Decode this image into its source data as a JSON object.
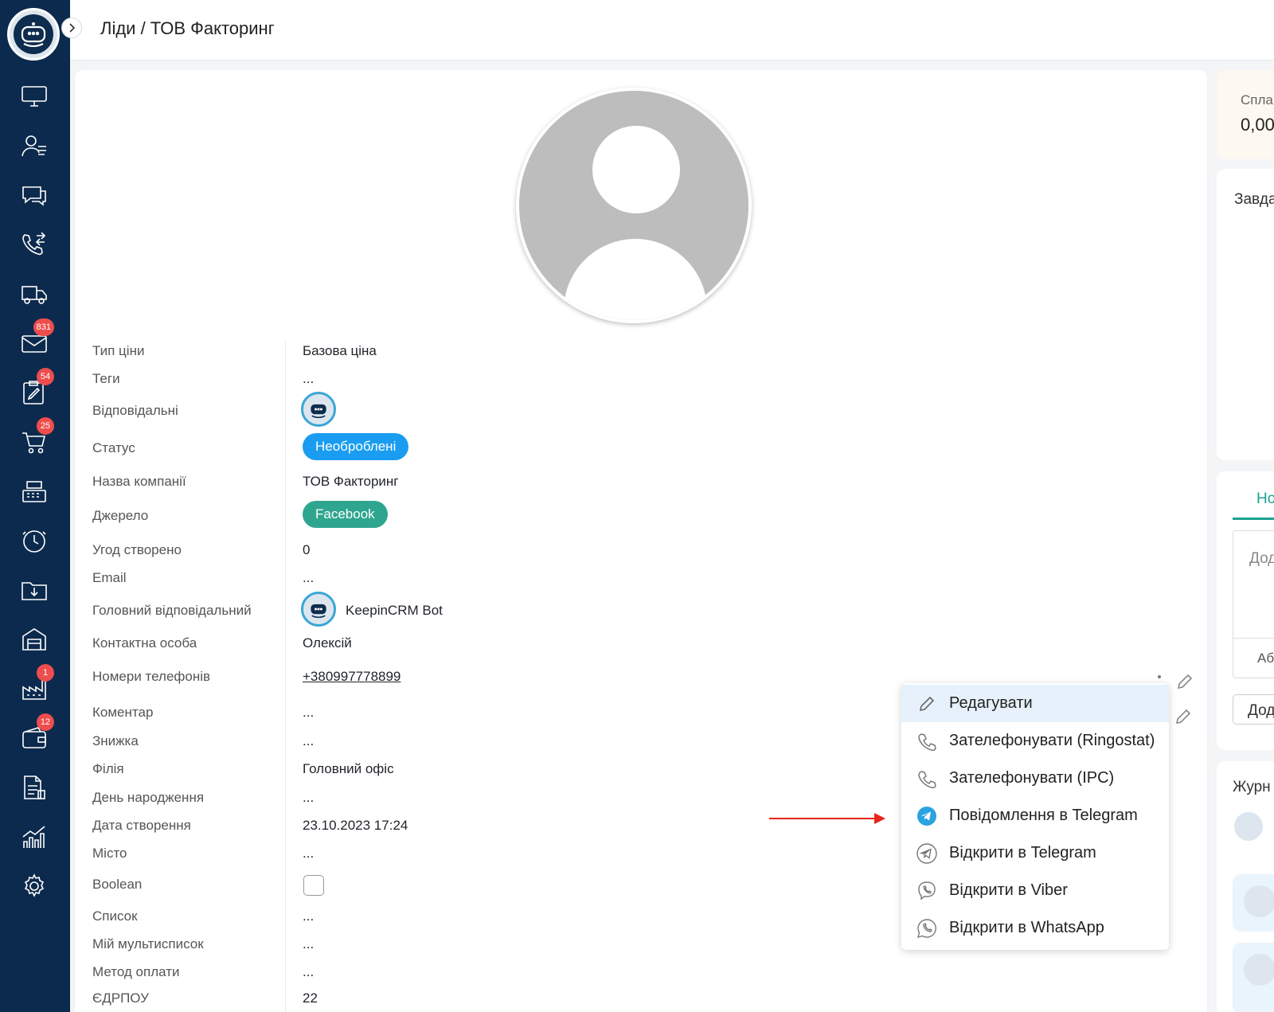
{
  "sidebar": {
    "items": [
      {
        "name": "desktop-icon"
      },
      {
        "name": "contacts-icon"
      },
      {
        "name": "chat-icon"
      },
      {
        "name": "calls-icon"
      },
      {
        "name": "delivery-icon"
      },
      {
        "name": "mail-icon",
        "badge": "831"
      },
      {
        "name": "tasks-icon",
        "badge": "54"
      },
      {
        "name": "cart-icon",
        "badge": "25"
      },
      {
        "name": "cash-register-icon"
      },
      {
        "name": "clock-icon"
      },
      {
        "name": "download-folder-icon"
      },
      {
        "name": "warehouse-icon"
      },
      {
        "name": "factory-icon",
        "badge": "1"
      },
      {
        "name": "wallet-icon",
        "badge": "12"
      },
      {
        "name": "documents-icon"
      },
      {
        "name": "analytics-icon"
      },
      {
        "name": "settings-icon"
      }
    ]
  },
  "header": {
    "breadcrumb": "Ліди / ТОВ Факторинг"
  },
  "fields": {
    "price_type": {
      "label": "Тип ціни",
      "value": "Базова ціна"
    },
    "tags": {
      "label": "Теги",
      "value": "..."
    },
    "responsible": {
      "label": "Відповідальні"
    },
    "status": {
      "label": "Статус",
      "value": "Необроблені",
      "color": "#1a9df0"
    },
    "company": {
      "label": "Назва компанії",
      "value": "ТОВ Факторинг"
    },
    "source": {
      "label": "Джерело",
      "value": "Facebook",
      "color": "#2ea68f"
    },
    "deals": {
      "label": "Угод створено",
      "value": "0"
    },
    "email": {
      "label": "Email",
      "value": "..."
    },
    "main_responsible": {
      "label": "Головний відповідальний",
      "value": "KeepinCRM Bot"
    },
    "contact": {
      "label": "Контактна особа",
      "value": "Олексій"
    },
    "phones": {
      "label": "Номери телефонів",
      "value": "+380997778899"
    },
    "comment": {
      "label": "Коментар",
      "value": "..."
    },
    "discount": {
      "label": "Знижка",
      "value": "..."
    },
    "branch": {
      "label": "Філія",
      "value": "Головний офіс"
    },
    "birthday": {
      "label": "День народження",
      "value": "..."
    },
    "created": {
      "label": "Дата створення",
      "value": "23.10.2023 17:24"
    },
    "city": {
      "label": "Місто",
      "value": "..."
    },
    "boolean": {
      "label": "Boolean"
    },
    "list": {
      "label": "Список",
      "value": "..."
    },
    "multilist": {
      "label": "Мій мультисписок",
      "value": "..."
    },
    "payment": {
      "label": "Метод оплати",
      "value": "..."
    },
    "edrpou": {
      "label": "ЄДРПОУ",
      "value": "22"
    }
  },
  "context_menu": {
    "items": [
      {
        "label": "Редагувати",
        "icon": "pencil-icon"
      },
      {
        "label": "Зателефонувати (Ringostat)",
        "icon": "phone-icon"
      },
      {
        "label": "Зателефонувати (IPC)",
        "icon": "phone-icon"
      },
      {
        "label": "Повідомлення в Telegram",
        "icon": "telegram-filled-icon"
      },
      {
        "label": "Відкрити в Telegram",
        "icon": "telegram-outline-icon"
      },
      {
        "label": "Відкрити в Viber",
        "icon": "viber-icon"
      },
      {
        "label": "Відкрити в WhatsApp",
        "icon": "whatsapp-icon"
      }
    ]
  },
  "right_panel": {
    "paid_label": "Спла",
    "paid_value": "0,00",
    "tasks_label": "Завда",
    "tab_label": "Но",
    "input_placeholder": "Дод",
    "small_text": "Аб",
    "add_button": "Дод",
    "journal_label": "Журн"
  },
  "colors": {
    "sidebar": "#0c2a4d",
    "accent": "#1a9df0",
    "source": "#2ea68f",
    "badge": "#ee4d4d"
  }
}
